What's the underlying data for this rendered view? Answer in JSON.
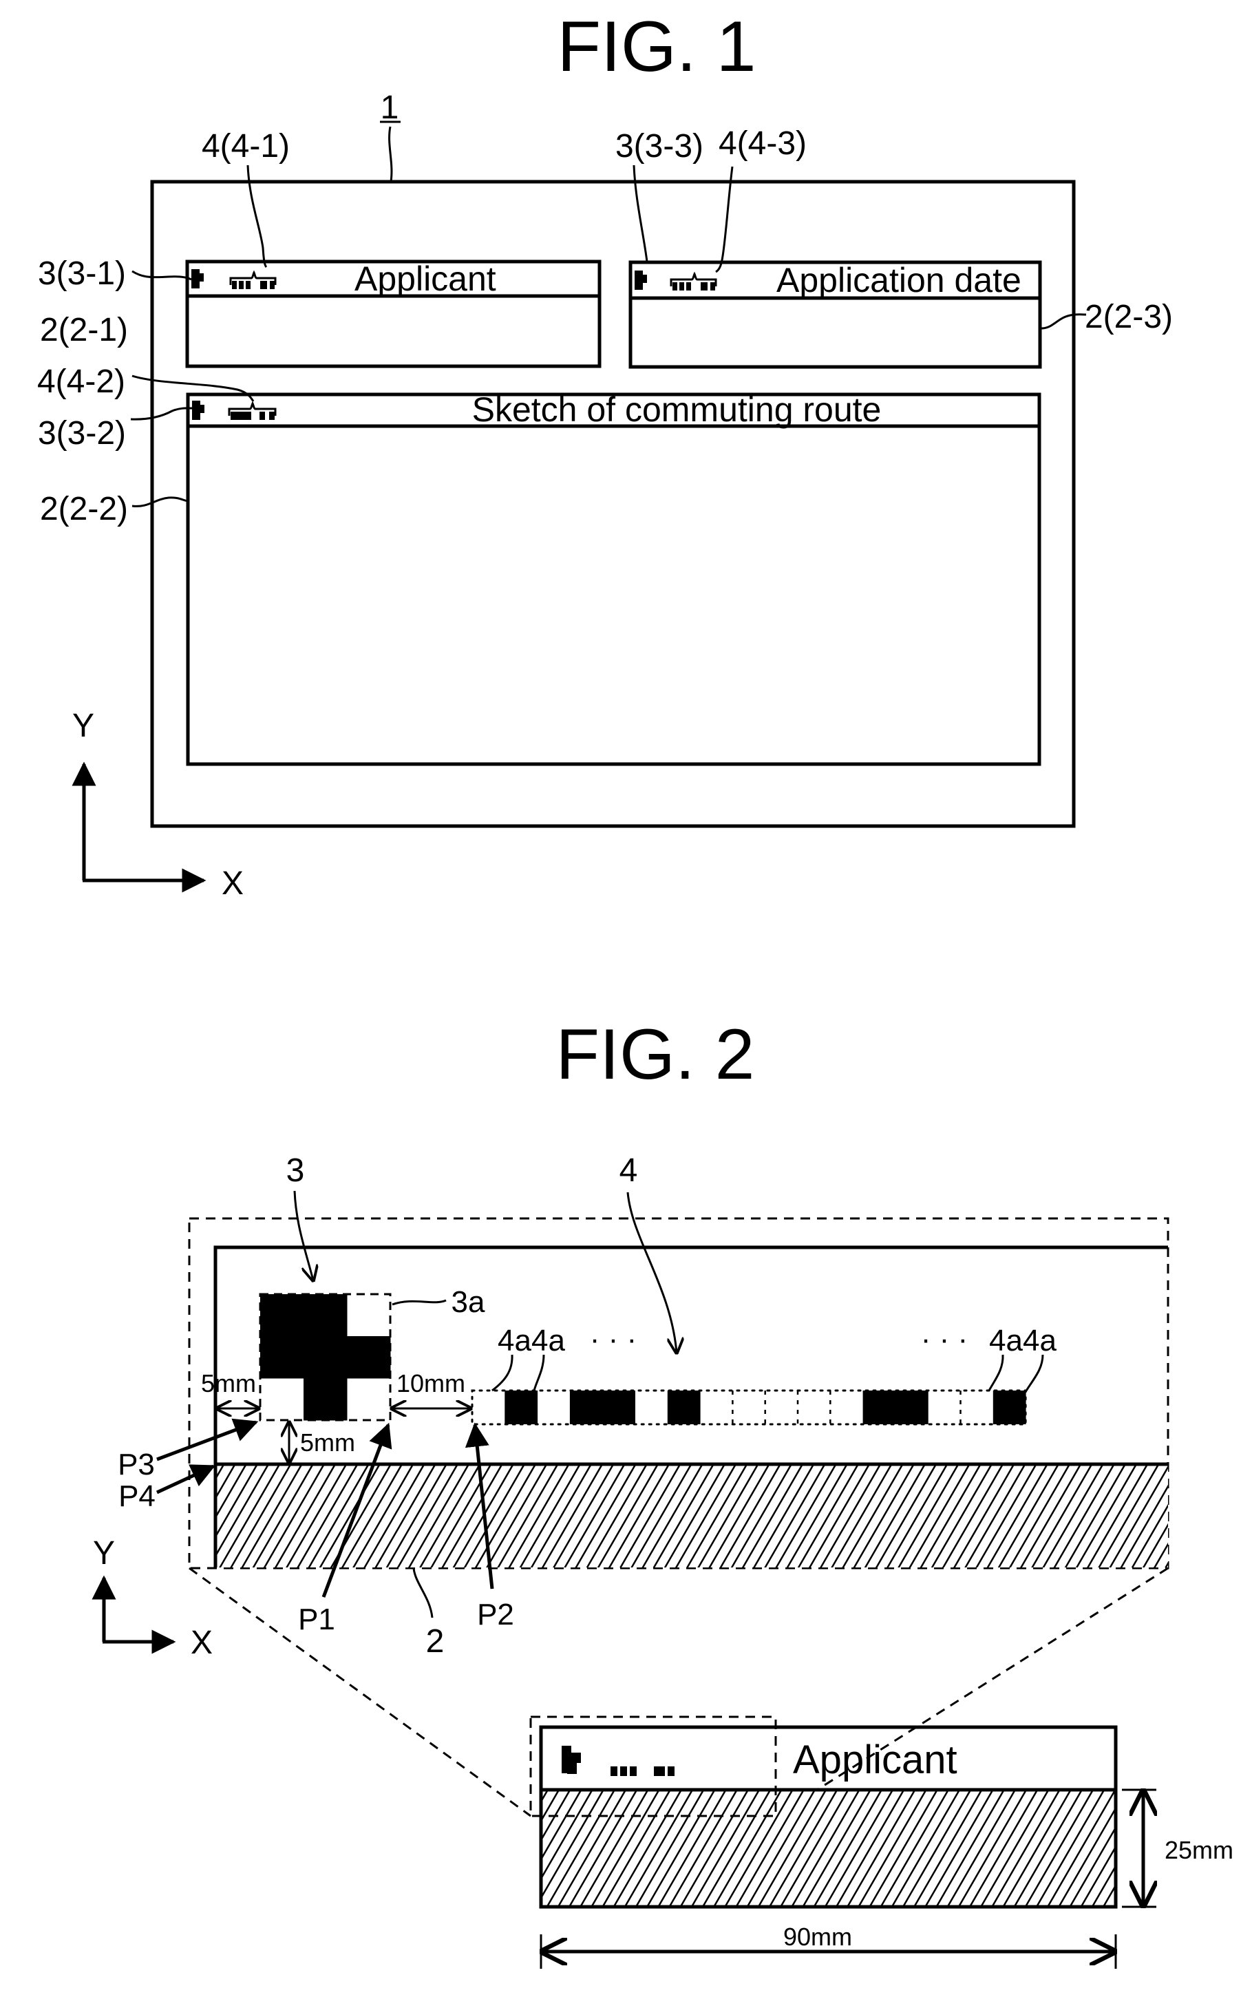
{
  "fig1": {
    "title": "FIG. 1",
    "sheet_ref": "1",
    "fields": [
      {
        "ref_mark": "3(3-1)",
        "ref_code": "4(4-1)",
        "ref_field": "2(2-1)",
        "label": "Applicant"
      },
      {
        "ref_mark": "3(3-2)",
        "ref_code": "4(4-2)",
        "ref_field": "2(2-2)",
        "label": "Sketch of commuting route"
      },
      {
        "ref_mark": "3(3-3)",
        "ref_code": "4(4-3)",
        "ref_field": "2(2-3)",
        "label": "Application date"
      }
    ],
    "axes": {
      "y": "Y",
      "x": "X"
    }
  },
  "fig2": {
    "title": "FIG. 2",
    "labels": {
      "mark": "3",
      "code": "4",
      "mark_cell": "3a",
      "code_cell": "4a",
      "code_cells_pair": "4a4a",
      "ellipsis": "· · ·",
      "field": "2",
      "p1": "P1",
      "p2": "P2",
      "p3": "P3",
      "p4": "P4"
    },
    "dimensions": {
      "mark_left_margin": "5mm",
      "mark_to_code_gap": "10mm",
      "mark_bottom_margin": "5mm",
      "field_width": "90mm",
      "field_height": "25mm"
    },
    "mark_pattern": [
      [
        1,
        1,
        0
      ],
      [
        1,
        1,
        1
      ],
      [
        0,
        1,
        0
      ]
    ],
    "code_pattern": [
      0,
      1,
      0,
      1,
      1,
      0,
      1,
      0,
      0,
      0,
      0,
      0,
      1,
      1,
      0,
      0,
      1
    ],
    "inset_label": "Applicant",
    "axes": {
      "y": "Y",
      "x": "X"
    }
  }
}
